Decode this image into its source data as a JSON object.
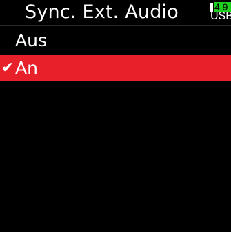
{
  "header": {
    "title": "Sync. Ext. Audio",
    "battery": {
      "voltage": "4.9",
      "source": "USB",
      "voltage_color": "#1ed11e"
    }
  },
  "menu": {
    "items": [
      {
        "label": "Aus",
        "selected": false
      },
      {
        "label": "An",
        "selected": true
      }
    ],
    "check_glyph": "✔",
    "selection_color": "#e8202a"
  }
}
